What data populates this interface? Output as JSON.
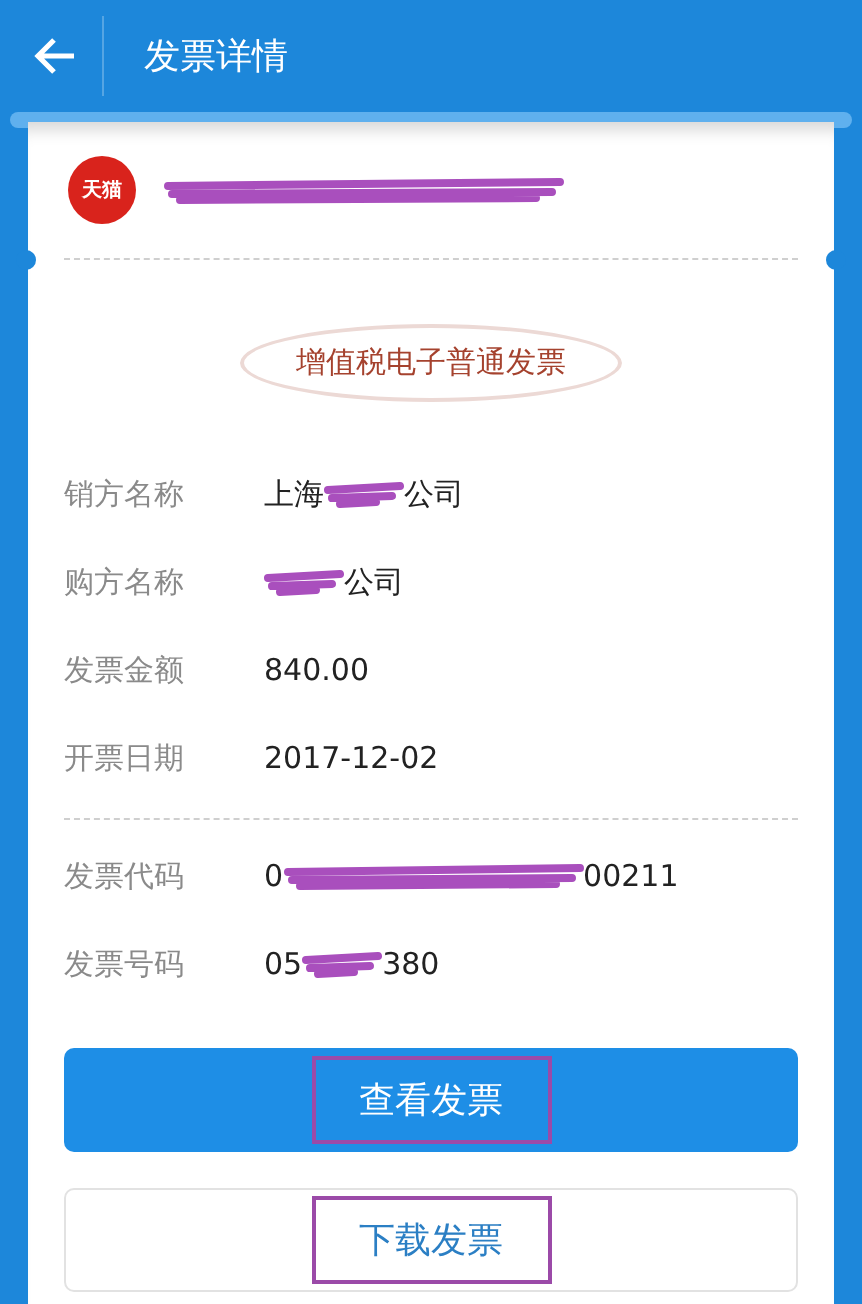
{
  "header": {
    "title": "发票详情"
  },
  "store": {
    "badge": "天猫",
    "name_redacted": true
  },
  "invoice_type": "增值税电子普通发票",
  "details": [
    {
      "label": "销方名称",
      "start": "上海",
      "end": "公司",
      "redacted": true
    },
    {
      "label": "购方名称",
      "end": "公司",
      "redacted": true
    },
    {
      "label": "发票金额",
      "start": "840.00",
      "redacted": false
    },
    {
      "label": "开票日期",
      "start": "2017-12-02",
      "redacted": false
    }
  ],
  "codes": [
    {
      "label": "发票代码",
      "start": "0",
      "end": "00211",
      "redacted": true
    },
    {
      "label": "发票号码",
      "start": "05",
      "end": "380",
      "redacted": true
    }
  ],
  "buttons": [
    {
      "label": "查看发票",
      "kind": "primary",
      "highlighted": true
    },
    {
      "label": "下载发票",
      "kind": "outline",
      "highlighted": true
    }
  ]
}
